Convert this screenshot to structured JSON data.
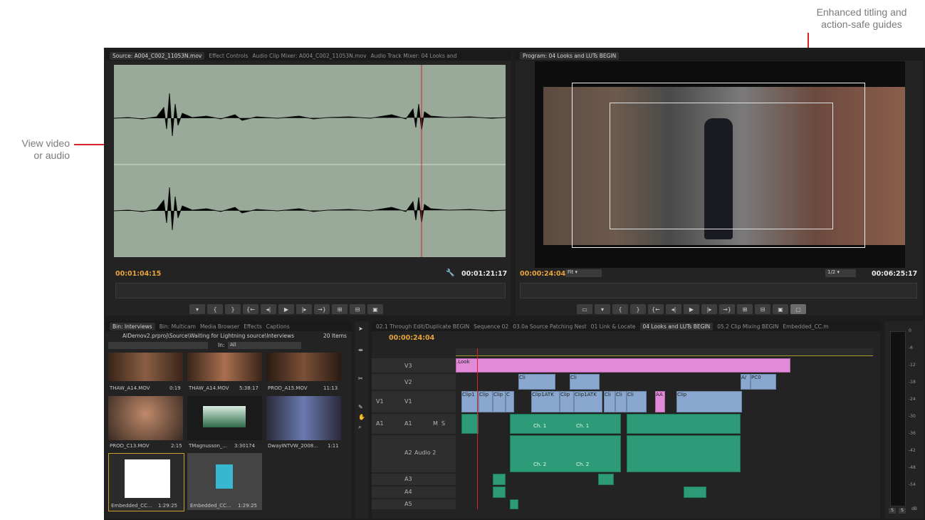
{
  "callouts": {
    "top_right": [
      "Enhanced titling and",
      "action-safe guides"
    ],
    "left": [
      "View video",
      "or audio"
    ]
  },
  "source": {
    "tabs": [
      "Source: A004_C002_11053N.mov",
      "Effect Controls",
      "Audio Clip Mixer: A004_C002_11053N.mov",
      "Audio Track Mixer: 04 Looks and"
    ],
    "timecode_in": "00:01:04:15",
    "timecode_dur": "00:01:21:17"
  },
  "program": {
    "tab": "Program: 04 Looks and LUTs BEGIN",
    "timecode_in": "00:00:24:04",
    "fit": "Fit",
    "res": "1/2",
    "timecode_dur": "00:06:25:17"
  },
  "bin": {
    "tabs": [
      "Bin: Interviews",
      "Bin: Multicam",
      "Media Browser",
      "Effects",
      "Captions"
    ],
    "path": "AlDemov2.prproj\\Source\\Waiting for Lightning source\\Interviews",
    "count": "20 Items",
    "in_label": "In:",
    "in_value": "All",
    "items": [
      {
        "name": "THAW_A14.MOV",
        "dur": "0:19"
      },
      {
        "name": "THAW_A14.MOV",
        "dur": "5:38:17"
      },
      {
        "name": "PROD_A15.MOV",
        "dur": "11:13"
      },
      {
        "name": "PROD_C13.MOV",
        "dur": "2:15"
      },
      {
        "name": "TMagnusson_...",
        "dur": "3:30174"
      },
      {
        "name": "DwayINTVW_2008...",
        "dur": "1:11"
      },
      {
        "name": "Embedded_CC...",
        "dur": "1:29:25"
      },
      {
        "name": "Embedded_CC...",
        "dur": "1:29:25"
      }
    ]
  },
  "timeline": {
    "tabs": [
      "02.1 Through Edit/Duplicate BEGIN",
      "Sequence 02",
      "03.0a Source Patching Nest",
      "01 Link & Locate",
      "04 Looks and LUTs BEGIN",
      "05.2 Clip Mixing BEGIN",
      "Embedded_CC.m"
    ],
    "timecode": "00:00:24:04",
    "tracks": {
      "v3": "V3",
      "v2": "V2",
      "v1": "V1",
      "v1_src": "V1",
      "a1": "A1",
      "a1_src": "A1",
      "a2": "A2",
      "a2_name": "Audio 2",
      "a3": "A3",
      "a4": "A4",
      "a5": "A5",
      "m": "M",
      "s": "S"
    },
    "clips": {
      "look": ".Look",
      "cl1": "Cli",
      "cl2": "Cli",
      "av": "A/",
      "pc": "PC0",
      "clip1": "Clip1",
      "clip": "Clip",
      "clipd": "Clip",
      "c": "C",
      "clip1atk": "Clip1ATK",
      "clip2": "Clip",
      "clip1atk2": "Clip1ATK",
      "cli3": "Cli",
      "cli4": "Cli",
      "cli5": "Cli",
      "aa": "AA",
      "clip3": "Clip",
      "ch1": "Ch. 1",
      "ch1b": "Ch. 1",
      "ch2": "Ch. 2",
      "ch2b": "Ch. 2"
    }
  },
  "meter": {
    "ticks": [
      "0",
      "-6",
      "-12",
      "-18",
      "-24",
      "-30",
      "-36",
      "-42",
      "-48",
      "-54"
    ],
    "db": "dB",
    "solo": [
      "S",
      "S"
    ]
  }
}
